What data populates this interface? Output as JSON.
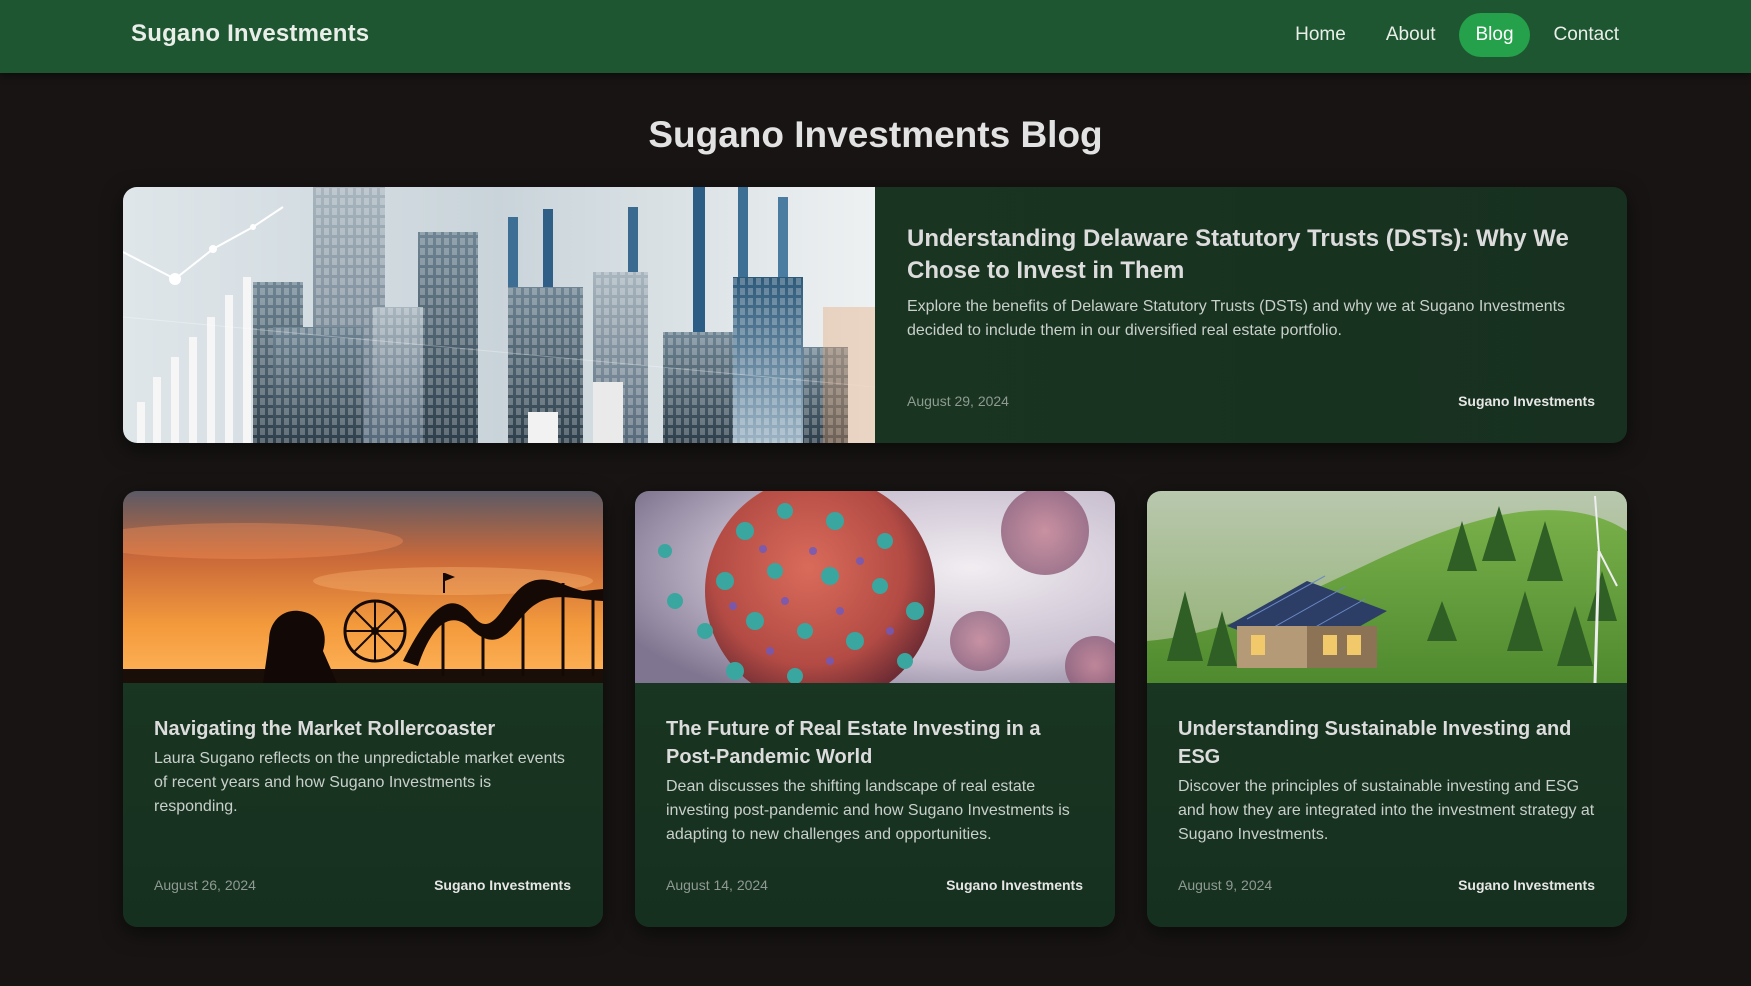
{
  "nav": {
    "brand": "Sugano Investments",
    "links": [
      {
        "label": "Home"
      },
      {
        "label": "About"
      },
      {
        "label": "Blog",
        "active": true
      },
      {
        "label": "Contact"
      }
    ]
  },
  "page": {
    "title": "Sugano Investments Blog"
  },
  "featured": {
    "title": "Understanding Delaware Statutory Trusts (DSTs): Why We Chose to Invest in Them",
    "excerpt": "Explore the benefits of Delaware Statutory Trusts (DSTs) and why we at Sugano Investments decided to include them in our diversified real estate portfolio.",
    "date": "August 29, 2024",
    "author": "Sugano Investments",
    "image_icon": "city-skyline-chart-image"
  },
  "posts": [
    {
      "title": "Navigating the Market Rollercoaster",
      "excerpt": "Laura Sugano reflects on the unpredictable market events of recent years and how Sugano Investments is responding.",
      "date": "August 26, 2024",
      "author": "Sugano Investments",
      "image_icon": "rollercoaster-sunset-image"
    },
    {
      "title": "The Future of Real Estate Investing in a Post-Pandemic World",
      "excerpt": "Dean discusses the shifting landscape of real estate investing post-pandemic and how Sugano Investments is adapting to new challenges and opportunities.",
      "date": "August 14, 2024",
      "author": "Sugano Investments",
      "image_icon": "virus-particles-image"
    },
    {
      "title": "Understanding Sustainable Investing and ESG",
      "excerpt": "Discover the principles of sustainable investing and ESG and how they are integrated into the investment strategy at Sugano Investments.",
      "date": "August 9, 2024",
      "author": "Sugano Investments",
      "image_icon": "solar-house-forest-image"
    }
  ],
  "colors": {
    "nav_bg": "#1e5631",
    "nav_active": "#25a14b",
    "page_bg": "#171413",
    "card_bg": "#1b3a24"
  }
}
